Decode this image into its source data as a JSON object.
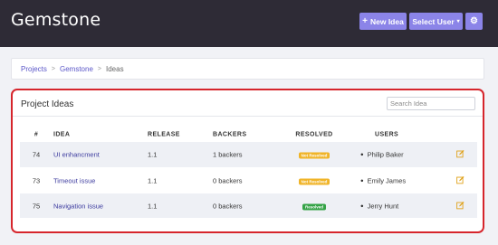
{
  "header": {
    "brand": "Gemstone",
    "new_idea_label": "New Idea",
    "select_user_label": "Select User",
    "plus_glyph": "+",
    "caret_glyph": "▾",
    "gear_glyph": "⚙"
  },
  "breadcrumb": {
    "items": [
      "Projects",
      "Gemstone",
      "Ideas"
    ],
    "separator": ">"
  },
  "panel": {
    "title": "Project Ideas",
    "search_placeholder": "Search Idea"
  },
  "table": {
    "headers": [
      "#",
      "IDEA",
      "RELEASE",
      "BACKERS",
      "RESOLVED",
      "USERS"
    ],
    "rows": [
      {
        "id": "74",
        "idea": "UI enhancment",
        "release": "1.1",
        "backers": "1 backers",
        "resolved": "Not Resolved",
        "resolved_state": "no",
        "user": "Philip Baker"
      },
      {
        "id": "73",
        "idea": "Timeout issue",
        "release": "1.1",
        "backers": "0 backers",
        "resolved": "Not Resolved",
        "resolved_state": "no",
        "user": "Emily James"
      },
      {
        "id": "75",
        "idea": "Navigation issue",
        "release": "1.1",
        "backers": "0 backers",
        "resolved": "Resolved",
        "resolved_state": "yes",
        "user": "Jerry Hunt"
      }
    ]
  },
  "colors": {
    "topbar": "#2e2b36",
    "accent": "#8b84e8",
    "panel_border": "#d6252c",
    "badge_not_resolved": "#f0b428",
    "badge_resolved": "#35a347",
    "edit_icon": "#e0a21a"
  }
}
